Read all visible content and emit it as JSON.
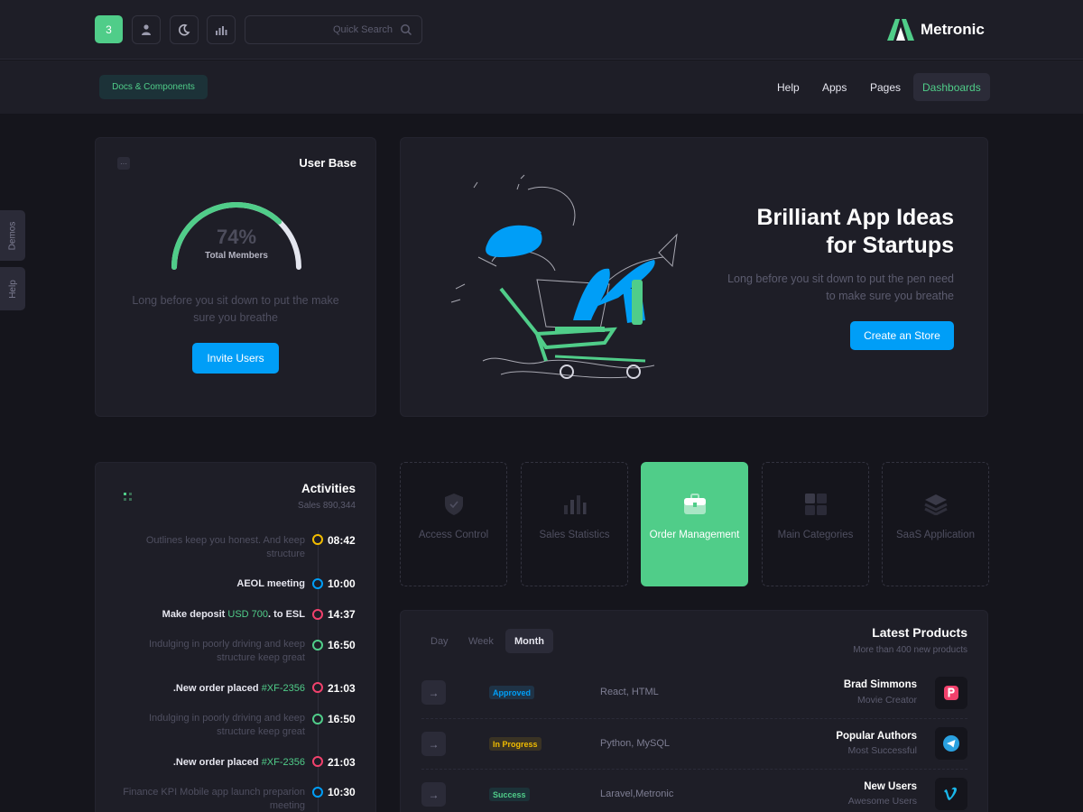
{
  "header": {
    "notification_count": "3",
    "icons": [
      "user-icon",
      "moon-icon",
      "chart-icon"
    ],
    "search_placeholder": "Quick Search",
    "brand": "Metronic"
  },
  "subheader": {
    "docs_label": "Docs & Components",
    "nav": [
      "Help",
      "Apps",
      "Pages",
      "Dashboards"
    ],
    "active_nav": "Dashboards"
  },
  "side_tabs": [
    "Demos",
    "Help"
  ],
  "user_base": {
    "title": "User Base",
    "percent": "74%",
    "percent_value": 74,
    "label": "Total Members",
    "description": "Long before you sit down to put the make sure you breathe",
    "button": "Invite Users"
  },
  "promo": {
    "title_line1": "Brilliant App Ideas",
    "title_line2": "for Startups",
    "description": "Long before you sit down to put the pen need to make sure you breathe",
    "button": "Create an Store"
  },
  "activities": {
    "title": "Activities",
    "subtitle": "Sales 890,344",
    "items": [
      {
        "text": "Outlines keep you honest. And keep structure",
        "time": "08:42",
        "strong": false,
        "color": "#f1bc00"
      },
      {
        "text": "AEOL meeting",
        "time": "10:00",
        "strong": true,
        "color": "#009ef7"
      },
      {
        "pre": "Make deposit ",
        "hl": "USD 700",
        "post": ". to ESL",
        "time": "14:37",
        "strong": true,
        "color": "#f1416c"
      },
      {
        "text": "Indulging in poorly driving and keep structure keep great",
        "time": "16:50",
        "strong": false,
        "color": "#50cd89"
      },
      {
        "pre": ".New order placed ",
        "hl": "#XF-2356",
        "post": "",
        "time": "21:03",
        "strong": true,
        "color": "#f1416c"
      },
      {
        "text": "Indulging in poorly driving and keep structure keep great",
        "time": "16:50",
        "strong": false,
        "color": "#50cd89"
      },
      {
        "pre": ".New order placed ",
        "hl": "#XF-2356",
        "post": "",
        "time": "21:03",
        "strong": true,
        "color": "#f1416c"
      },
      {
        "text": "Finance KPI Mobile app launch preparion meeting",
        "time": "10:30",
        "strong": false,
        "color": "#009ef7"
      }
    ]
  },
  "tiles": [
    {
      "label": "Access Control",
      "icon": "shield-icon",
      "active": false
    },
    {
      "label": "Sales Statistics",
      "icon": "bar-chart-icon",
      "active": false
    },
    {
      "label": "Order Management",
      "icon": "briefcase-icon",
      "active": true
    },
    {
      "label": "Main Categories",
      "icon": "grid-icon",
      "active": false
    },
    {
      "label": "SaaS Application",
      "icon": "layers-icon",
      "active": false
    }
  ],
  "latest_products": {
    "title": "Latest Products",
    "subtitle": "More than 400 new products",
    "tabs": [
      "Day",
      "Week",
      "Month"
    ],
    "active_tab": "Month",
    "rows": [
      {
        "status": "Approved",
        "status_color": "#009ef7",
        "status_bg": "#1f3346",
        "tech": "React, HTML",
        "name": "Brad Simmons",
        "role": "Movie Creator",
        "logo": "p-logo-icon"
      },
      {
        "status": "In Progress",
        "status_color": "#f1bc00",
        "status_bg": "#3a3324",
        "tech": "Python, MySQL",
        "name": "Popular Authors",
        "role": "Most Successful",
        "logo": "telegram-icon"
      },
      {
        "status": "Success",
        "status_color": "#50cd89",
        "status_bg": "#1c3238",
        "tech": "Laravel,Metronic",
        "name": "New Users",
        "role": "Awesome Users",
        "logo": "vimeo-icon"
      }
    ]
  },
  "colors": {
    "accent_green": "#50cd89",
    "accent_blue": "#009ef7",
    "background": "#15151c",
    "card": "#1e1e27"
  }
}
